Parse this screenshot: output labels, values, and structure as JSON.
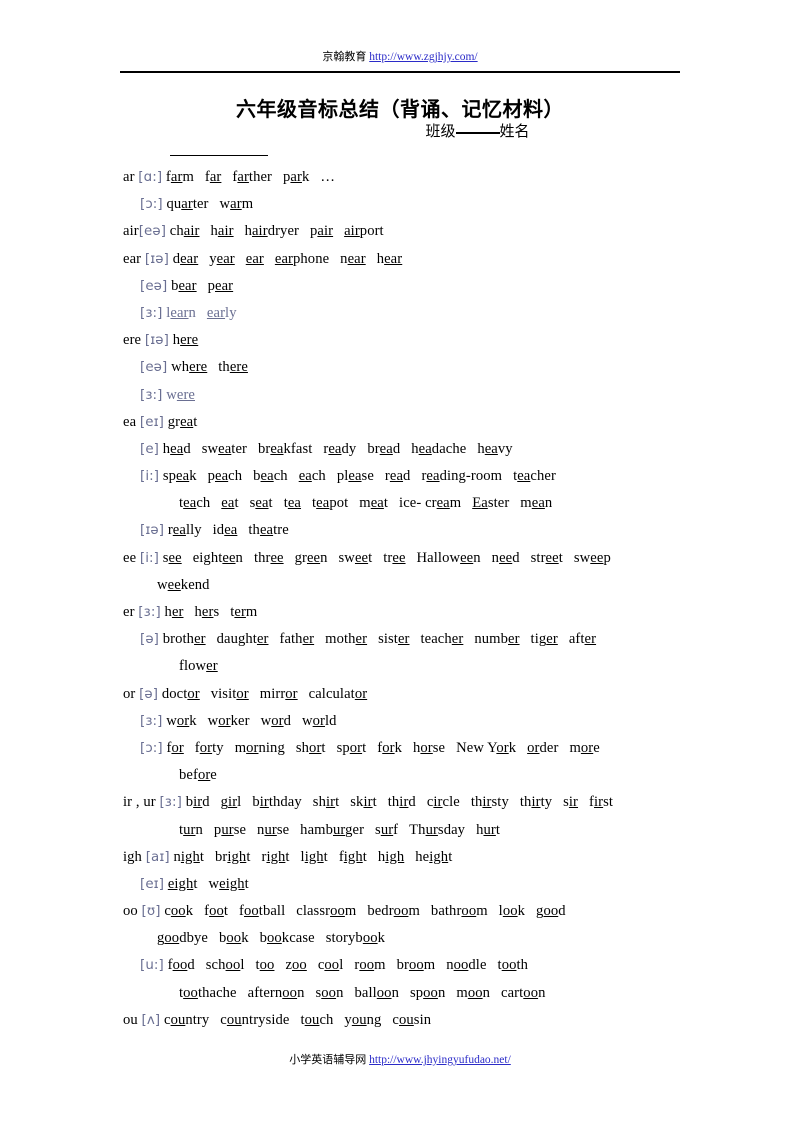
{
  "header": {
    "org": "京翰教育",
    "url": "http://www.zgjhjy.com/"
  },
  "title": "六年级音标总结（背诵、记忆材料）",
  "class_line": {
    "class_label": "班级",
    "name_label": "姓名"
  },
  "footer": {
    "org": "小学英语辅导网",
    "url": "http://www.jhyingyufudao.net/"
  },
  "colors": {
    "phonetic": "#6a6f92",
    "link": "#2b2bc8",
    "text": "#000000"
  },
  "lines": [
    {
      "indent": 0,
      "key": "ar ",
      "phonetic": "[ɑ:]",
      "gray_words": false,
      "words": [
        {
          "pre": "f",
          "mid": "ar",
          "post": "m"
        },
        {
          "pre": "f",
          "mid": "ar",
          "post": ""
        },
        {
          "pre": "f",
          "mid": "ar",
          "post": "ther"
        },
        {
          "pre": "p",
          "mid": "ar",
          "post": "k"
        },
        {
          "pre": "…",
          "mid": "",
          "post": ""
        }
      ]
    },
    {
      "indent": 1,
      "key": "",
      "phonetic": "[ɔ:]",
      "gray_words": false,
      "words": [
        {
          "pre": "qu",
          "mid": "ar",
          "post": "ter"
        },
        {
          "pre": "w",
          "mid": "ar",
          "post": "m"
        }
      ]
    },
    {
      "indent": 0,
      "key": "air",
      "phonetic": "[eə]",
      "gray_words": false,
      "words": [
        {
          "pre": "ch",
          "mid": "air",
          "post": ""
        },
        {
          "pre": "h",
          "mid": "air",
          "post": ""
        },
        {
          "pre": "h",
          "mid": "air",
          "post": "dryer"
        },
        {
          "pre": "p",
          "mid": "air",
          "post": ""
        },
        {
          "pre": "",
          "mid": "air",
          "post": "port"
        }
      ]
    },
    {
      "indent": 0,
      "key": "ear ",
      "phonetic": "[ɪə]",
      "gray_words": false,
      "words": [
        {
          "pre": "d",
          "mid": "ear",
          "post": ""
        },
        {
          "pre": "y",
          "mid": "ear",
          "post": ""
        },
        {
          "pre": "",
          "mid": "ear",
          "post": ""
        },
        {
          "pre": "",
          "mid": "ear",
          "post": "phone"
        },
        {
          "pre": "n",
          "mid": "ear",
          "post": ""
        },
        {
          "pre": "h",
          "mid": "ear",
          "post": ""
        }
      ]
    },
    {
      "indent": 1,
      "key": "",
      "phonetic": "[eə]",
      "gray_words": false,
      "words": [
        {
          "pre": "b",
          "mid": "ear",
          "post": ""
        },
        {
          "pre": "p",
          "mid": "ear",
          "post": ""
        }
      ]
    },
    {
      "indent": 1,
      "key": "",
      "phonetic": "[ɜ:]",
      "gray_words": true,
      "words": [
        {
          "pre": "l",
          "mid": "ear",
          "post": "n"
        },
        {
          "pre": "",
          "mid": "ear",
          "post": "ly"
        }
      ]
    },
    {
      "indent": 0,
      "key": "ere ",
      "phonetic": "[ɪə]",
      "gray_words": false,
      "words": [
        {
          "pre": "h",
          "mid": "ere",
          "post": ""
        }
      ]
    },
    {
      "indent": 1,
      "key": "",
      "phonetic": "[eə]",
      "gray_words": false,
      "words": [
        {
          "pre": "wh",
          "mid": "ere",
          "post": ""
        },
        {
          "pre": "th",
          "mid": "ere",
          "post": ""
        }
      ]
    },
    {
      "indent": 1,
      "key": "",
      "phonetic": "[ɜ:]",
      "gray_words": true,
      "words": [
        {
          "pre": "w",
          "mid": "ere",
          "post": ""
        }
      ]
    },
    {
      "indent": 0,
      "key": "ea ",
      "phonetic": "[eɪ]",
      "gray_words": false,
      "words": [
        {
          "pre": "gr",
          "mid": "ea",
          "post": "t"
        }
      ]
    },
    {
      "indent": 1,
      "key": "",
      "phonetic": "[e]",
      "gray_words": false,
      "words": [
        {
          "pre": "h",
          "mid": "ea",
          "post": "d"
        },
        {
          "pre": "sw",
          "mid": "ea",
          "post": "ter"
        },
        {
          "pre": "br",
          "mid": "ea",
          "post": "kfast"
        },
        {
          "pre": "r",
          "mid": "ea",
          "post": "dy"
        },
        {
          "pre": "br",
          "mid": "ea",
          "post": "d"
        },
        {
          "pre": "h",
          "mid": "ea",
          "post": "dache"
        },
        {
          "pre": "h",
          "mid": "ea",
          "post": "vy"
        }
      ]
    },
    {
      "indent": 1,
      "key": "",
      "phonetic": "[i:]",
      "gray_words": false,
      "words": [
        {
          "pre": "sp",
          "mid": "ea",
          "post": "k"
        },
        {
          "pre": "p",
          "mid": "ea",
          "post": "ch"
        },
        {
          "pre": "b",
          "mid": "ea",
          "post": "ch"
        },
        {
          "pre": "",
          "mid": "ea",
          "post": "ch"
        },
        {
          "pre": "pl",
          "mid": "ea",
          "post": "se"
        },
        {
          "pre": "r",
          "mid": "ea",
          "post": "d"
        },
        {
          "pre": "r",
          "mid": "ea",
          "post": "ding-room"
        },
        {
          "pre": "t",
          "mid": "ea",
          "post": "cher"
        }
      ]
    },
    {
      "indent": 3,
      "key": "",
      "phonetic": "",
      "gray_words": false,
      "words": [
        {
          "pre": "t",
          "mid": "ea",
          "post": "ch"
        },
        {
          "pre": "",
          "mid": "ea",
          "post": "t"
        },
        {
          "pre": "s",
          "mid": "ea",
          "post": "t"
        },
        {
          "pre": "t",
          "mid": "ea",
          "post": ""
        },
        {
          "pre": "t",
          "mid": "ea",
          "post": "pot"
        },
        {
          "pre": "m",
          "mid": "ea",
          "post": "t"
        },
        {
          "pre": "ice- cr",
          "mid": "ea",
          "post": "m"
        },
        {
          "pre": "",
          "mid": "Ea",
          "post": "ster"
        },
        {
          "pre": "m",
          "mid": "ea",
          "post": "n"
        }
      ]
    },
    {
      "indent": 1,
      "key": "",
      "phonetic": "[ɪə]",
      "gray_words": false,
      "words": [
        {
          "pre": "r",
          "mid": "ea",
          "post": "lly"
        },
        {
          "pre": "id",
          "mid": "ea",
          "post": ""
        },
        {
          "pre": "th",
          "mid": "ea",
          "post": "tre"
        }
      ]
    },
    {
      "indent": 0,
      "key": "ee ",
      "phonetic": "[i:]",
      "gray_words": false,
      "words": [
        {
          "pre": "s",
          "mid": "ee",
          "post": ""
        },
        {
          "pre": "eight",
          "mid": "ee",
          "post": "n"
        },
        {
          "pre": "thr",
          "mid": "ee",
          "post": ""
        },
        {
          "pre": "gr",
          "mid": "ee",
          "post": "n"
        },
        {
          "pre": "sw",
          "mid": "ee",
          "post": "t"
        },
        {
          "pre": "tr",
          "mid": "ee",
          "post": ""
        },
        {
          "pre": "Hallow",
          "mid": "ee",
          "post": "n"
        },
        {
          "pre": "n",
          "mid": "ee",
          "post": "d"
        },
        {
          "pre": "str",
          "mid": "ee",
          "post": "t"
        },
        {
          "pre": "sw",
          "mid": "ee",
          "post": "p"
        }
      ]
    },
    {
      "indent": 2,
      "key": "",
      "phonetic": "",
      "gray_words": false,
      "words": [
        {
          "pre": "w",
          "mid": "ee",
          "post": "kend"
        }
      ]
    },
    {
      "indent": 0,
      "key": "er ",
      "phonetic": "[ɜ:]",
      "gray_words": false,
      "words": [
        {
          "pre": "h",
          "mid": "er",
          "post": ""
        },
        {
          "pre": "h",
          "mid": "er",
          "post": "s"
        },
        {
          "pre": "t",
          "mid": "er",
          "post": "m"
        }
      ]
    },
    {
      "indent": 1,
      "key": "",
      "phonetic": "[ə]",
      "gray_words": false,
      "words": [
        {
          "pre": "broth",
          "mid": "er",
          "post": ""
        },
        {
          "pre": "daught",
          "mid": "er",
          "post": ""
        },
        {
          "pre": "fath",
          "mid": "er",
          "post": ""
        },
        {
          "pre": "moth",
          "mid": "er",
          "post": ""
        },
        {
          "pre": "sist",
          "mid": "er",
          "post": ""
        },
        {
          "pre": "teach",
          "mid": "er",
          "post": ""
        },
        {
          "pre": "numb",
          "mid": "er",
          "post": ""
        },
        {
          "pre": "tig",
          "mid": "er",
          "post": ""
        },
        {
          "pre": "aft",
          "mid": "er",
          "post": ""
        }
      ]
    },
    {
      "indent": 3,
      "key": "",
      "phonetic": "",
      "gray_words": false,
      "words": [
        {
          "pre": "flow",
          "mid": "er",
          "post": ""
        }
      ]
    },
    {
      "indent": 0,
      "key": "or ",
      "phonetic": "[ə]",
      "gray_words": false,
      "words": [
        {
          "pre": "doct",
          "mid": "or",
          "post": ""
        },
        {
          "pre": "visit",
          "mid": "or",
          "post": ""
        },
        {
          "pre": "mirr",
          "mid": "or",
          "post": ""
        },
        {
          "pre": "calculat",
          "mid": "or",
          "post": ""
        }
      ]
    },
    {
      "indent": 1,
      "key": "",
      "phonetic": "[ɜ:]",
      "gray_words": false,
      "words": [
        {
          "pre": "w",
          "mid": "or",
          "post": "k"
        },
        {
          "pre": "w",
          "mid": "or",
          "post": "ker"
        },
        {
          "pre": "w",
          "mid": "or",
          "post": "d"
        },
        {
          "pre": "w",
          "mid": "or",
          "post": "ld"
        }
      ]
    },
    {
      "indent": 1,
      "key": "",
      "phonetic": "[ɔ:]",
      "gray_words": false,
      "words": [
        {
          "pre": "f",
          "mid": "or",
          "post": ""
        },
        {
          "pre": "f",
          "mid": "or",
          "post": "ty"
        },
        {
          "pre": "m",
          "mid": "or",
          "post": "ning"
        },
        {
          "pre": "sh",
          "mid": "or",
          "post": "t"
        },
        {
          "pre": "sp",
          "mid": "or",
          "post": "t"
        },
        {
          "pre": "f",
          "mid": "or",
          "post": "k"
        },
        {
          "pre": "h",
          "mid": "or",
          "post": "se"
        },
        {
          "pre": "New Y",
          "mid": "or",
          "post": "k"
        },
        {
          "pre": "",
          "mid": "or",
          "post": "der"
        },
        {
          "pre": "m",
          "mid": "or",
          "post": "e"
        }
      ]
    },
    {
      "indent": 3,
      "key": "",
      "phonetic": "",
      "gray_words": false,
      "words": [
        {
          "pre": "bef",
          "mid": "or",
          "post": "e"
        }
      ]
    },
    {
      "indent": 0,
      "key": "ir , ur ",
      "phonetic": "[ɜ:]",
      "gray_words": false,
      "words": [
        {
          "pre": "b",
          "mid": "ir",
          "post": "d"
        },
        {
          "pre": "g",
          "mid": "ir",
          "post": "l"
        },
        {
          "pre": "b",
          "mid": "ir",
          "post": "thday"
        },
        {
          "pre": "sh",
          "mid": "ir",
          "post": "t"
        },
        {
          "pre": "sk",
          "mid": "ir",
          "post": "t"
        },
        {
          "pre": "th",
          "mid": "ir",
          "post": "d"
        },
        {
          "pre": "c",
          "mid": "ir",
          "post": "cle"
        },
        {
          "pre": "th",
          "mid": "ir",
          "post": "sty"
        },
        {
          "pre": "th",
          "mid": "ir",
          "post": "ty"
        },
        {
          "pre": "s",
          "mid": "ir",
          "post": ""
        },
        {
          "pre": "f",
          "mid": "ir",
          "post": "st"
        }
      ]
    },
    {
      "indent": 3,
      "key": "",
      "phonetic": "",
      "gray_words": false,
      "words": [
        {
          "pre": "t",
          "mid": "ur",
          "post": "n"
        },
        {
          "pre": "p",
          "mid": "ur",
          "post": "se"
        },
        {
          "pre": "n",
          "mid": "ur",
          "post": "se"
        },
        {
          "pre": "hamb",
          "mid": "ur",
          "post": "ger"
        },
        {
          "pre": "s",
          "mid": "ur",
          "post": "f"
        },
        {
          "pre": "Th",
          "mid": "ur",
          "post": "sday"
        },
        {
          "pre": "h",
          "mid": "ur",
          "post": "t"
        }
      ]
    },
    {
      "indent": 0,
      "key": "igh ",
      "phonetic": "[aɪ]",
      "gray_words": false,
      "words": [
        {
          "pre": "n",
          "mid": "igh",
          "post": "t"
        },
        {
          "pre": "br",
          "mid": "igh",
          "post": "t"
        },
        {
          "pre": "r",
          "mid": "igh",
          "post": "t"
        },
        {
          "pre": "l",
          "mid": "igh",
          "post": "t"
        },
        {
          "pre": "f",
          "mid": "igh",
          "post": "t"
        },
        {
          "pre": "h",
          "mid": "igh",
          "post": ""
        },
        {
          "pre": "he",
          "mid": "igh",
          "post": "t"
        }
      ]
    },
    {
      "indent": 1,
      "key": "",
      "phonetic": "[eɪ]",
      "gray_words": false,
      "words": [
        {
          "pre": "",
          "mid": "eigh",
          "post": "t"
        },
        {
          "pre": "w",
          "mid": "eigh",
          "post": "t"
        }
      ]
    },
    {
      "indent": 0,
      "key": "oo ",
      "phonetic": "[ʊ]",
      "gray_words": false,
      "words": [
        {
          "pre": "c",
          "mid": "oo",
          "post": "k"
        },
        {
          "pre": "f",
          "mid": "oo",
          "post": "t"
        },
        {
          "pre": "f",
          "mid": "oo",
          "post": "tball"
        },
        {
          "pre": "classr",
          "mid": "oo",
          "post": "m"
        },
        {
          "pre": "bedr",
          "mid": "oo",
          "post": "m"
        },
        {
          "pre": "bathr",
          "mid": "oo",
          "post": "m"
        },
        {
          "pre": "l",
          "mid": "oo",
          "post": "k"
        },
        {
          "pre": "g",
          "mid": "oo",
          "post": "d"
        }
      ]
    },
    {
      "indent": 2,
      "key": "",
      "phonetic": "",
      "gray_words": false,
      "words": [
        {
          "pre": "g",
          "mid": "oo",
          "post": "dbye"
        },
        {
          "pre": "b",
          "mid": "oo",
          "post": "k"
        },
        {
          "pre": "b",
          "mid": "oo",
          "post": "kcase"
        },
        {
          "pre": "storyb",
          "mid": "oo",
          "post": "k"
        }
      ]
    },
    {
      "indent": 1,
      "key": "",
      "phonetic": "[u:]",
      "gray_words": false,
      "words": [
        {
          "pre": "f",
          "mid": "oo",
          "post": "d"
        },
        {
          "pre": "sch",
          "mid": "oo",
          "post": "l"
        },
        {
          "pre": "t",
          "mid": "oo",
          "post": ""
        },
        {
          "pre": "z",
          "mid": "oo",
          "post": ""
        },
        {
          "pre": "c",
          "mid": "oo",
          "post": "l"
        },
        {
          "pre": "r",
          "mid": "oo",
          "post": "m"
        },
        {
          "pre": "br",
          "mid": "oo",
          "post": "m"
        },
        {
          "pre": "n",
          "mid": "oo",
          "post": "dle"
        },
        {
          "pre": "t",
          "mid": "oo",
          "post": "th"
        }
      ]
    },
    {
      "indent": 3,
      "key": "",
      "phonetic": "",
      "gray_words": false,
      "words": [
        {
          "pre": "t",
          "mid": "oo",
          "post": "thache"
        },
        {
          "pre": "aftern",
          "mid": "oo",
          "post": "n"
        },
        {
          "pre": "s",
          "mid": "oo",
          "post": "n"
        },
        {
          "pre": "ball",
          "mid": "oo",
          "post": "n"
        },
        {
          "pre": "sp",
          "mid": "oo",
          "post": "n"
        },
        {
          "pre": "m",
          "mid": "oo",
          "post": "n"
        },
        {
          "pre": "cart",
          "mid": "oo",
          "post": "n"
        }
      ]
    },
    {
      "indent": 0,
      "key": "ou ",
      "phonetic": "[ʌ]",
      "gray_words": false,
      "words": [
        {
          "pre": "c",
          "mid": "ou",
          "post": "ntry"
        },
        {
          "pre": "c",
          "mid": "ou",
          "post": "ntryside"
        },
        {
          "pre": "t",
          "mid": "ou",
          "post": "ch"
        },
        {
          "pre": "y",
          "mid": "ou",
          "post": "ng"
        },
        {
          "pre": "c",
          "mid": "ou",
          "post": "sin"
        }
      ]
    }
  ]
}
